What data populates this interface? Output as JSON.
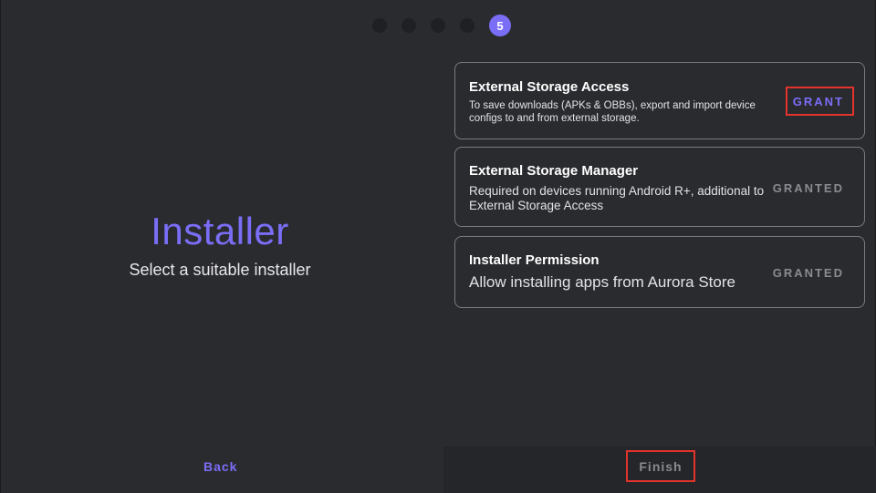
{
  "steps": {
    "count": 5,
    "current": 5,
    "current_label": "5"
  },
  "intro": {
    "title": "Installer",
    "subtitle": "Select a suitable installer"
  },
  "permissions": [
    {
      "title": "External Storage Access",
      "description": "To save downloads (APKs & OBBs), export and import device configs to and from external storage.",
      "action": "GRANT",
      "state": "pending"
    },
    {
      "title": "External Storage Manager",
      "description": "Required on devices running Android R+, additional to External Storage Access",
      "action": "GRANTED",
      "state": "granted"
    },
    {
      "title": "Installer Permission",
      "description": "Allow installing apps from Aurora Store",
      "action": "GRANTED",
      "state": "granted"
    }
  ],
  "footer": {
    "back_label": "Back",
    "finish_label": "Finish"
  },
  "colors": {
    "accent": "#7b6ef6",
    "background": "#2a2b2f",
    "highlight": "#e4332a",
    "muted": "#8a8b90"
  }
}
